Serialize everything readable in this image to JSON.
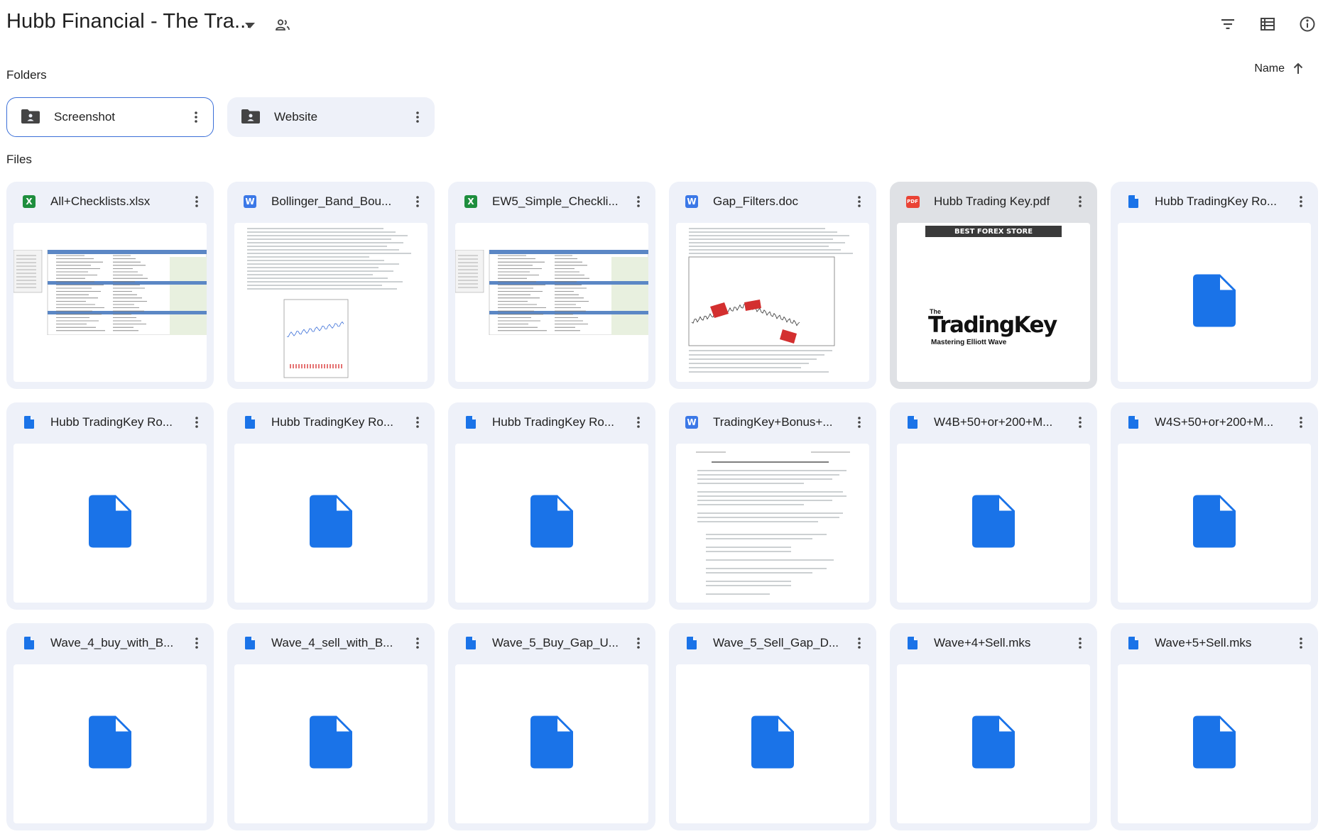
{
  "header": {
    "title": "Hubb Financial - The Tra...",
    "icons": [
      "dropdown-caret-icon",
      "shared-people-icon",
      "filter-icon",
      "list-view-icon",
      "info-icon"
    ]
  },
  "folders_label": "Folders",
  "files_label": "Files",
  "sort": {
    "label": "Name",
    "direction": "ascending"
  },
  "folders": [
    {
      "name": "Screenshot",
      "selected": true
    },
    {
      "name": "Website",
      "selected": false
    }
  ],
  "files": [
    {
      "name": "All+Checklists.xlsx",
      "type": "xlsx",
      "badge": "X",
      "thumb": "spreadsheet"
    },
    {
      "name": "Bollinger_Band_Bou...",
      "type": "doc",
      "badge": "W",
      "thumb": "document-chart"
    },
    {
      "name": "EW5_Simple_Checkli...",
      "type": "xlsx",
      "badge": "X",
      "thumb": "spreadsheet"
    },
    {
      "name": "Gap_Filters.doc",
      "type": "doc",
      "badge": "W",
      "thumb": "document-chart"
    },
    {
      "name": "Hubb Trading Key.pdf",
      "type": "pdf",
      "badge": "PDF",
      "thumb": "cover",
      "cover": {
        "banner": "BEST FOREX STORE",
        "the": "The",
        "title": "TradingKey",
        "subtitle": "Mastering Elliott Wave"
      }
    },
    {
      "name": "Hubb TradingKey Ro...",
      "type": "file",
      "thumb": "generic"
    },
    {
      "name": "Hubb TradingKey Ro...",
      "type": "file",
      "thumb": "generic"
    },
    {
      "name": "Hubb TradingKey Ro...",
      "type": "file",
      "thumb": "generic"
    },
    {
      "name": "Hubb TradingKey Ro...",
      "type": "file",
      "thumb": "generic"
    },
    {
      "name": "TradingKey+Bonus+...",
      "type": "doc",
      "badge": "W",
      "thumb": "document-text"
    },
    {
      "name": "W4B+50+or+200+M...",
      "type": "file",
      "thumb": "generic"
    },
    {
      "name": "W4S+50+or+200+M...",
      "type": "file",
      "thumb": "generic"
    },
    {
      "name": "Wave_4_buy_with_B...",
      "type": "file",
      "thumb": "generic"
    },
    {
      "name": "Wave_4_sell_with_B...",
      "type": "file",
      "thumb": "generic"
    },
    {
      "name": "Wave_5_Buy_Gap_U...",
      "type": "file",
      "thumb": "generic"
    },
    {
      "name": "Wave_5_Sell_Gap_D...",
      "type": "file",
      "thumb": "generic"
    },
    {
      "name": "Wave+4+Sell.mks",
      "type": "file",
      "thumb": "generic"
    },
    {
      "name": "Wave+5+Sell.mks",
      "type": "file",
      "thumb": "generic"
    }
  ],
  "colors": {
    "accent": "#1a73e8",
    "card_bg": "#eef1f9",
    "excel": "#1e8e3e",
    "word": "#3b78e7",
    "pdf": "#ea4335"
  }
}
